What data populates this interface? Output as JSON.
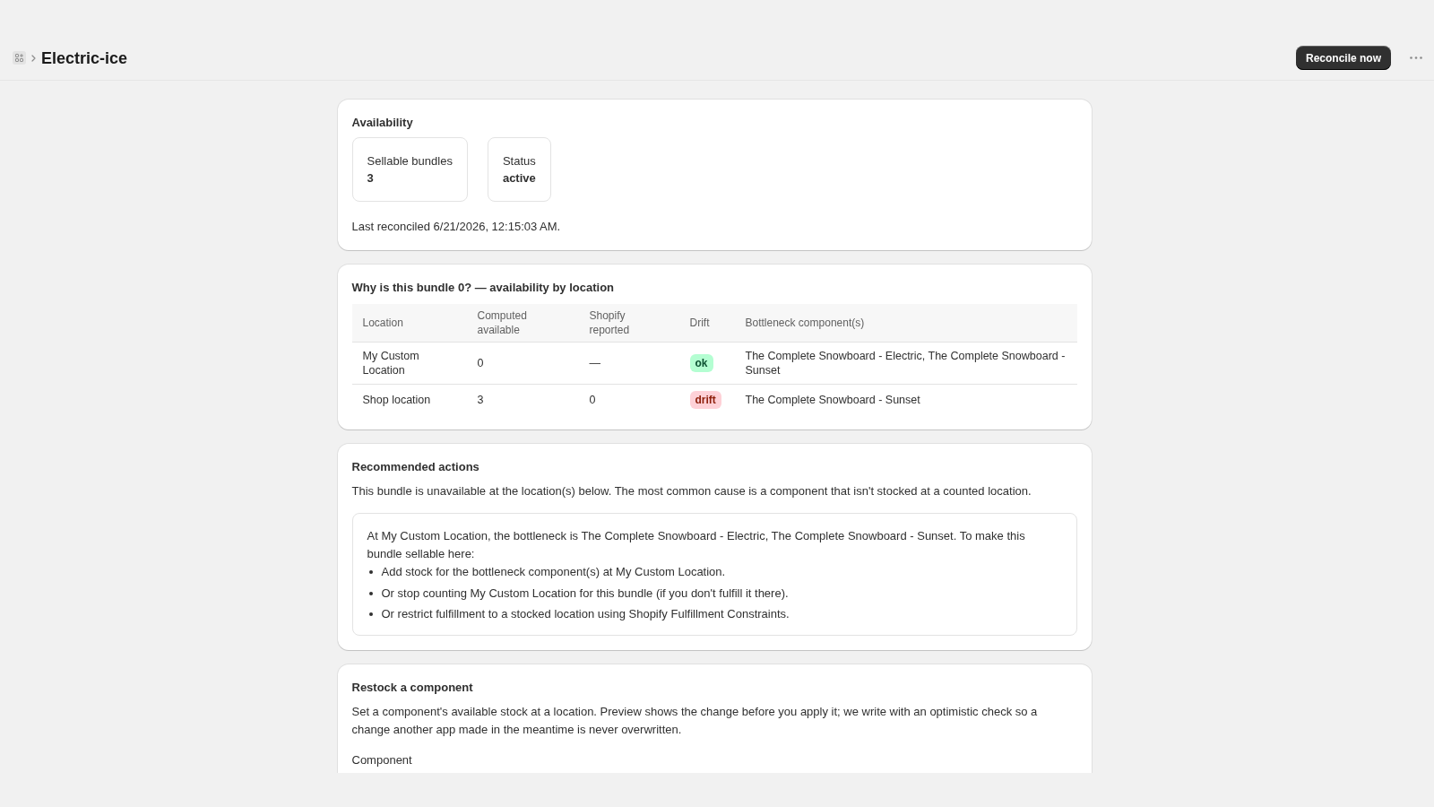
{
  "header": {
    "title": "Electric-ice",
    "primary_action": "Reconcile now"
  },
  "availability": {
    "title": "Availability",
    "stats": [
      {
        "label": "Sellable bundles",
        "value": "3"
      },
      {
        "label": "Status",
        "value": "active"
      }
    ],
    "last_reconciled": "Last reconciled 6/21/2026, 12:15:03 AM."
  },
  "location_table": {
    "title": "Why is this bundle 0? — availability by location",
    "columns": [
      "Location",
      "Computed available",
      "Shopify reported",
      "Drift",
      "Bottleneck component(s)"
    ],
    "rows": [
      {
        "location": "My Custom Location",
        "computed": "0",
        "reported": "—",
        "drift": {
          "label": "ok",
          "kind": "success"
        },
        "bottleneck": "The Complete Snowboard - Electric, The Complete Snowboard - Sunset"
      },
      {
        "location": "Shop location",
        "computed": "3",
        "reported": "0",
        "drift": {
          "label": "drift",
          "kind": "critical"
        },
        "bottleneck": "The Complete Snowboard - Sunset"
      }
    ]
  },
  "recommended_actions": {
    "title": "Recommended actions",
    "intro": "This bundle is unavailable at the location(s) below. The most common cause is a component that isn't stocked at a counted location.",
    "callout": {
      "text": "At My Custom Location, the bottleneck is The Complete Snowboard - Electric, The Complete Snowboard - Sunset. To make this bundle sellable here:",
      "steps": [
        "Add stock for the bottleneck component(s) at My Custom Location.",
        "Or stop counting My Custom Location for this bundle (if you don't fulfill it there).",
        "Or restrict fulfillment to a stocked location using Shopify Fulfillment Constraints."
      ]
    }
  },
  "restock": {
    "title": "Restock a component",
    "description": "Set a component's available stock at a location. Preview shows the change before you apply it; we write with an optimistic check so a change another app made in the meantime is never overwritten.",
    "field_label": "Component"
  }
}
